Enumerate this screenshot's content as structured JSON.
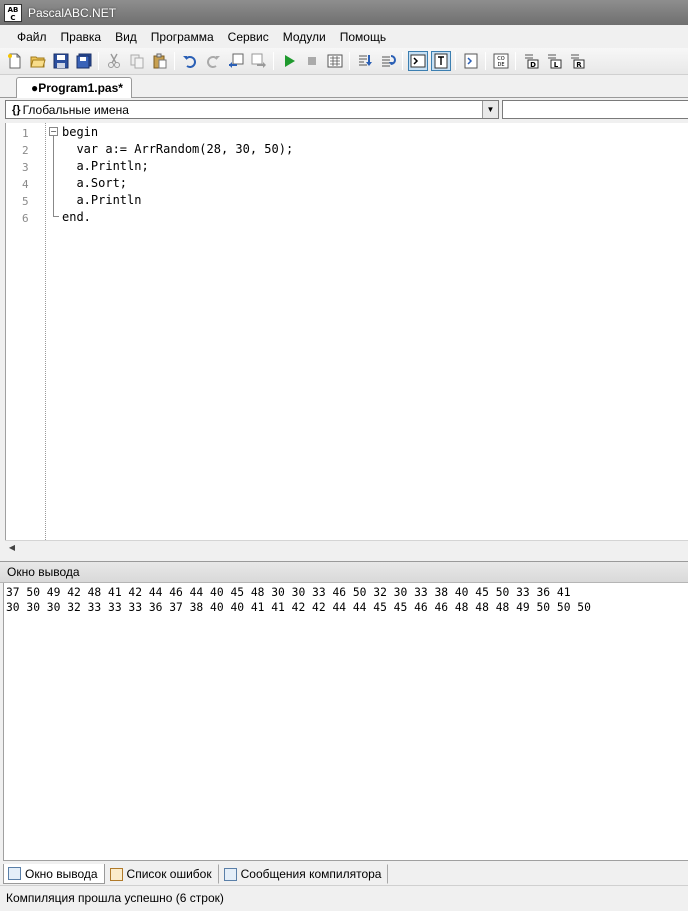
{
  "window": {
    "title": "PascalABC.NET",
    "icon_text": "AB\nC"
  },
  "menu": {
    "items": [
      "Файл",
      "Правка",
      "Вид",
      "Программа",
      "Сервис",
      "Модули",
      "Помощь"
    ]
  },
  "toolbar": {
    "buttons": [
      "new-file-icon",
      "open-folder-icon",
      "save-icon",
      "save-all-icon",
      "cut-icon",
      "copy-icon",
      "paste-icon",
      "undo-icon",
      "redo-icon",
      "back-icon",
      "forward-icon",
      "run-icon",
      "stop-icon",
      "compile-icon",
      "step-into-icon",
      "step-over-icon",
      "console-icon",
      "text-mode-icon",
      "format-icon",
      "code-template-icon",
      "debug-d-icon",
      "debug-l-icon",
      "debug-r-icon"
    ]
  },
  "tabs": {
    "active_file": "●Program1.pas*"
  },
  "scope": {
    "icon": "{}",
    "value": "Глобальные имена"
  },
  "editor": {
    "line_numbers": [
      "1",
      "2",
      "3",
      "4",
      "5",
      "6"
    ],
    "lines": [
      "begin",
      "  var a:= ArrRandom(28, 30, 50);",
      "  a.Println;",
      "  a.Sort;",
      "  a.Println",
      "end."
    ]
  },
  "output": {
    "title": "Окно вывода",
    "lines": [
      "37 50 49 42 48 41 42 44 46 44 40 45 48 30 30 33 46 50 32 30 33 38 40 45 50 33 36 41",
      "30 30 30 32 33 33 33 36 37 38 40 40 41 41 42 42 44 44 45 45 46 46 48 48 48 49 50 50 50"
    ]
  },
  "bottom_tabs": [
    "Окно вывода",
    "Список ошибок",
    "Сообщения компилятора"
  ],
  "status": {
    "text": "Компиляция прошла успешно (6 строк)"
  }
}
